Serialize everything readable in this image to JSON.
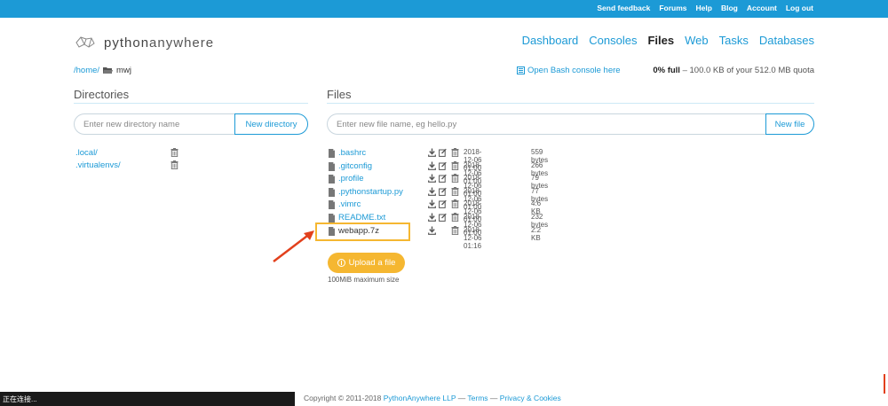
{
  "topbar": {
    "links": [
      "Send feedback",
      "Forums",
      "Help",
      "Blog",
      "Account",
      "Log out"
    ],
    "bg_color": "#1c9ad6"
  },
  "logo": {
    "text_prefix": "python",
    "text_suffix": "anywhere",
    "icon": "python-snake-logo-icon"
  },
  "nav": {
    "items": [
      "Dashboard",
      "Consoles",
      "Files",
      "Web",
      "Tasks",
      "Databases"
    ],
    "active": "Files"
  },
  "breadcrumb": {
    "root": "/home/",
    "current": "mwj",
    "icon": "folder-open-icon"
  },
  "bash_console": {
    "label": "Open Bash console here",
    "icon": "console-icon"
  },
  "quota": {
    "percent": "0% full",
    "detail": " – 100.0 KB of your 512.0 MB quota"
  },
  "directories": {
    "title": "Directories",
    "input_placeholder": "Enter new directory name",
    "button_label": "New directory",
    "items": [
      {
        "name": ".local/"
      },
      {
        "name": ".virtualenvs/"
      }
    ]
  },
  "files": {
    "title": "Files",
    "input_placeholder": "Enter new file name, eg hello.py",
    "button_label": "New file",
    "items": [
      {
        "name": ".bashrc",
        "date": "2018-12-06 01:00",
        "size": "559 bytes",
        "editable": true
      },
      {
        "name": ".gitconfig",
        "date": "2018-12-06 01:00",
        "size": "266 bytes",
        "editable": true
      },
      {
        "name": ".profile",
        "date": "2018-12-06 01:00",
        "size": "79 bytes",
        "editable": true
      },
      {
        "name": ".pythonstartup.py",
        "date": "2018-12-06 01:00",
        "size": "77 bytes",
        "editable": true
      },
      {
        "name": ".vimrc",
        "date": "2018-12-06 01:00",
        "size": "4.6 KB",
        "editable": true
      },
      {
        "name": "README.txt",
        "date": "2018-12-06 01:00",
        "size": "232 bytes",
        "editable": true
      },
      {
        "name": "webapp.7z",
        "date": "2018-12-06 01:16",
        "size": "2.2 KB",
        "editable": false
      }
    ]
  },
  "upload": {
    "label": "Upload a file",
    "note": "100MiB maximum size",
    "color": "#f5b731"
  },
  "annotation": {
    "highlight_color": "#f5b731",
    "arrow_color": "#e2401c"
  },
  "footer": {
    "copyright": "Copyright © 2011-2018 ",
    "company": "PythonAnywhere LLP",
    "sep1": " — ",
    "terms": "Terms",
    "sep2": " — ",
    "privacy": "Privacy & Cookies"
  },
  "status_bar": {
    "text": "正在连接..."
  }
}
